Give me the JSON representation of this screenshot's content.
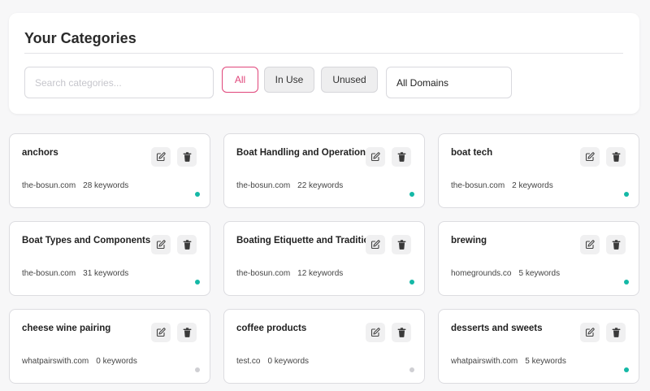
{
  "header": {
    "title": "Your Categories",
    "search_placeholder": "Search categories...",
    "filters": [
      {
        "label": "All",
        "active": true
      },
      {
        "label": "In Use",
        "active": false
      },
      {
        "label": "Unused",
        "active": false
      }
    ],
    "domain_select": "All Domains"
  },
  "colors": {
    "accent": "#e0457a",
    "status_active": "#14b8a6",
    "status_inactive": "#cfcfd3"
  },
  "icons": {
    "edit": "edit-icon",
    "delete": "trash-icon"
  },
  "cards": [
    {
      "title": "anchors",
      "domain": "the-bosun.com",
      "keywords": "28 keywords",
      "in_use": true
    },
    {
      "title": "Boat Handling and Operation",
      "domain": "the-bosun.com",
      "keywords": "22 keywords",
      "in_use": true
    },
    {
      "title": "boat tech",
      "domain": "the-bosun.com",
      "keywords": "2 keywords",
      "in_use": true
    },
    {
      "title": "Boat Types and Components",
      "domain": "the-bosun.com",
      "keywords": "31 keywords",
      "in_use": true
    },
    {
      "title": "Boating Etiquette and Traditions",
      "domain": "the-bosun.com",
      "keywords": "12 keywords",
      "in_use": true
    },
    {
      "title": "brewing",
      "domain": "homegrounds.co",
      "keywords": "5 keywords",
      "in_use": true
    },
    {
      "title": "cheese wine pairing",
      "domain": "whatpairswith.com",
      "keywords": "0 keywords",
      "in_use": false
    },
    {
      "title": "coffee products",
      "domain": "test.co",
      "keywords": "0 keywords",
      "in_use": false
    },
    {
      "title": "desserts and sweets",
      "domain": "whatpairswith.com",
      "keywords": "5 keywords",
      "in_use": true
    }
  ]
}
